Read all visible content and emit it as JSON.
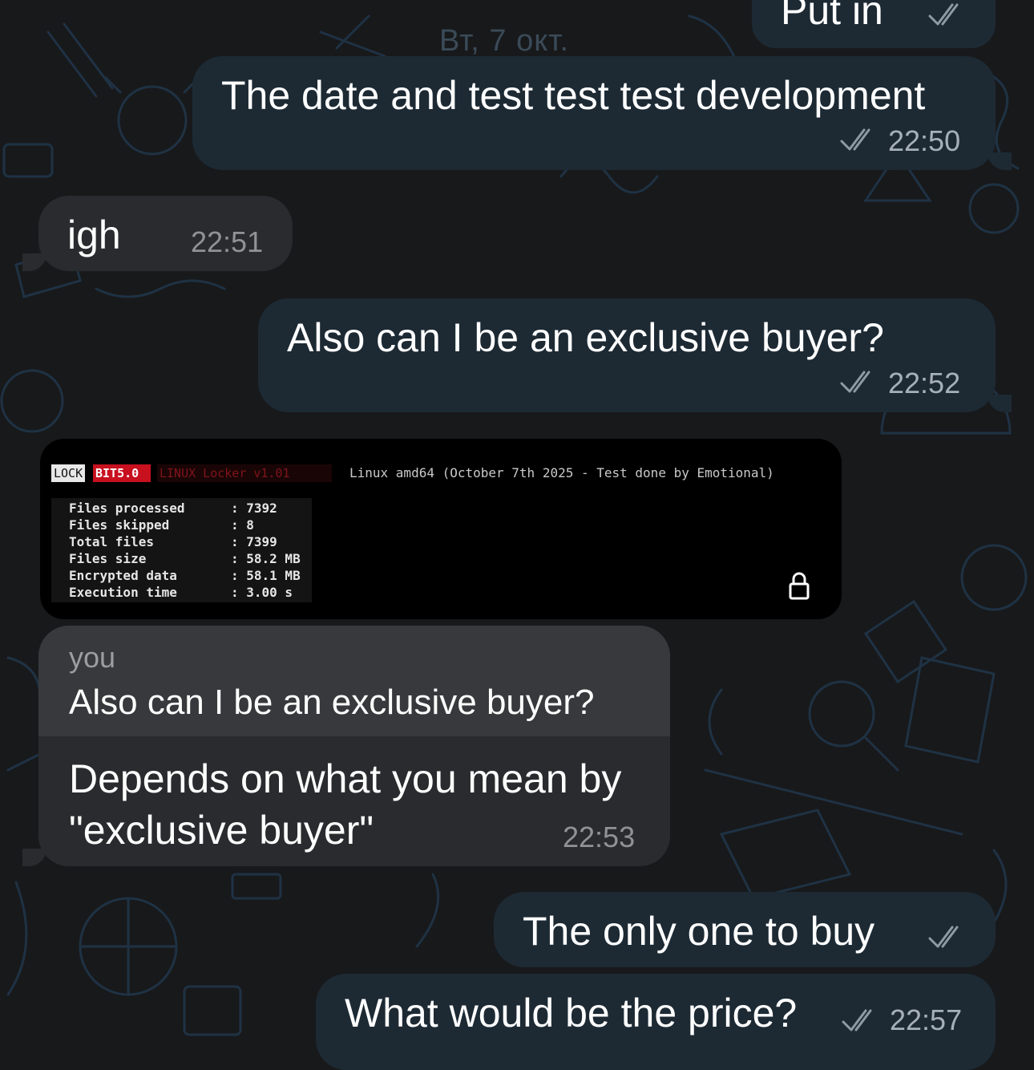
{
  "chat": {
    "date_separator": "Вт, 7 окт.",
    "messages": [
      {
        "id": "m1",
        "direction": "out",
        "text": "Put in",
        "time": "",
        "status": "read"
      },
      {
        "id": "m2",
        "direction": "out",
        "text": "The date and test test test development",
        "time": "22:50",
        "status": "read"
      },
      {
        "id": "m3",
        "direction": "in",
        "text": "igh",
        "time": "22:51"
      },
      {
        "id": "m4",
        "direction": "out",
        "text": "Also can I be an exclusive buyer?",
        "time": "22:52",
        "status": "read"
      },
      {
        "id": "m5",
        "direction": "in",
        "type": "image",
        "image": {
          "tag_lock": "LOCK",
          "tag_bit": "BIT5.0",
          "tag_linux": "LINUX Locker v1.01",
          "header": "Linux amd64 (October 7th 2025 - Test done by Emotional)",
          "stats": [
            {
              "label": "Files processed",
              "value": ": 7392"
            },
            {
              "label": "Files skipped",
              "value": ": 8"
            },
            {
              "label": "Total files",
              "value": ": 7399"
            },
            {
              "label": "Files size",
              "value": ": 58.2 MB"
            },
            {
              "label": "Encrypted data",
              "value": ": 58.1 MB"
            },
            {
              "label": "Execution time",
              "value": ": 3.00 s"
            }
          ],
          "icon": "lock-icon"
        }
      },
      {
        "id": "m6",
        "direction": "in",
        "reply_to": {
          "author": "you",
          "text": "Also can I be an exclusive buyer?"
        },
        "lines": [
          "Depends on what you mean by",
          "\"exclusive buyer\""
        ],
        "time": "22:53"
      },
      {
        "id": "m7",
        "direction": "out",
        "text": "The only one to buy",
        "time": "",
        "status": "read"
      },
      {
        "id": "m8",
        "direction": "out",
        "text": "What would be the price?",
        "time": "22:57",
        "status": "read"
      }
    ]
  },
  "colors": {
    "background": "#18191b",
    "outgoing_bubble": "#1d2a34",
    "incoming_bubble": "#2a2b2e",
    "reply_quote": "#38393c",
    "pattern": "#1f3244",
    "lockbit_red": "#c8101e"
  }
}
